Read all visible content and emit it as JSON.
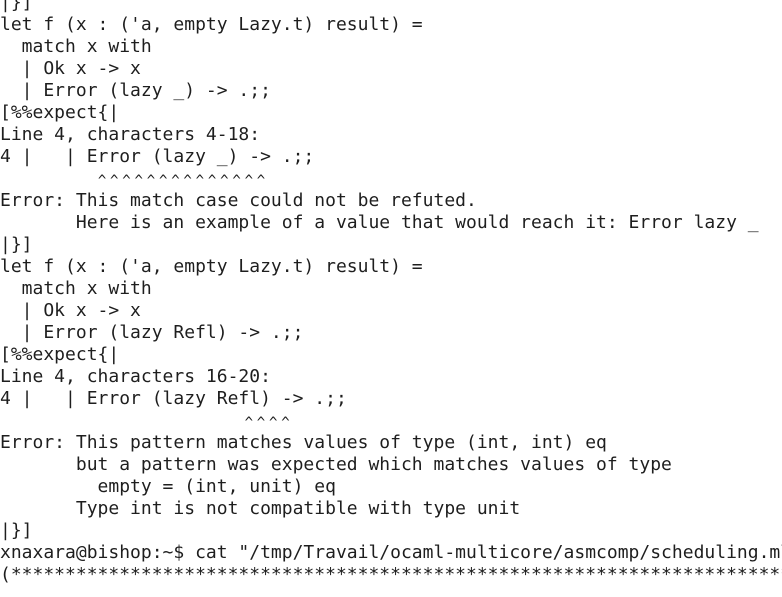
{
  "terminal": {
    "lines": [
      "|}]",
      "let f (x : ('a, empty Lazy.t) result) =",
      "  match x with",
      "  | Ok x -> x",
      "  | Error (lazy _) -> .;;",
      "[%%expect{|",
      "Line 4, characters 4-18:",
      "4 |   | Error (lazy _) -> .;;",
      "        ^^^^^^^^^^^^^^",
      "Error: This match case could not be refuted.",
      "       Here is an example of a value that would reach it: Error lazy _",
      "|}]",
      "let f (x : ('a, empty Lazy.t) result) =",
      "  match x with",
      "  | Ok x -> x",
      "  | Error (lazy Refl) -> .;;",
      "[%%expect{|",
      "Line 4, characters 16-20:",
      "4 |   | Error (lazy Refl) -> .;;",
      "                    ^^^^",
      "Error: This pattern matches values of type (int, int) eq",
      "       but a pattern was expected which matches values of type",
      "         empty = (int, unit) eq",
      "       Type int is not compatible with type unit",
      "|}]",
      "xnaxara@bishop:~$ cat \"/tmp/Travail/ocaml-multicore/asmcomp/scheduling.ml\"",
      "(**************************************************************************)"
    ]
  }
}
